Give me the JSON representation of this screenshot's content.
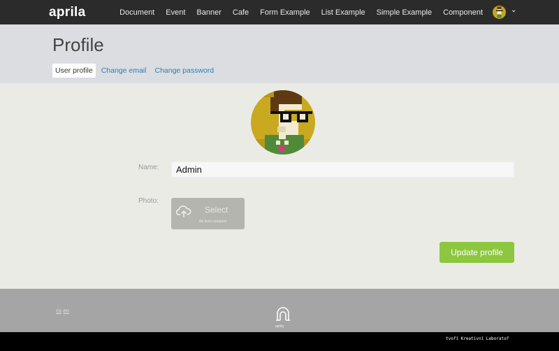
{
  "navbar": {
    "brand": "aprila",
    "links": [
      "Document",
      "Event",
      "Banner",
      "Cafe",
      "Form Example",
      "List Example",
      "Simple Example",
      "Component"
    ]
  },
  "header": {
    "title": "Profile",
    "tabs": [
      {
        "label": "User profile",
        "active": true
      },
      {
        "label": "Change email",
        "active": false
      },
      {
        "label": "Change password",
        "active": false
      }
    ]
  },
  "form": {
    "name_label": "Name:",
    "name_value": "Admin",
    "photo_label": "Photo:",
    "upload_title": "Select",
    "upload_subtitle": "file from computer",
    "submit_label": "Update profile"
  },
  "footer": {
    "languages": [
      "cs",
      "en"
    ],
    "logo_text": "aprila",
    "credit": "tvoří Kreativní Laboratoř"
  },
  "colors": {
    "navbar_bg": "#2b2b2b",
    "header_bg": "#dcdde1",
    "content_bg": "#ebebe6",
    "accent_link": "#2a7fb5",
    "submit_bg": "#8dc63f",
    "footer_bg": "#a4a5a4"
  }
}
